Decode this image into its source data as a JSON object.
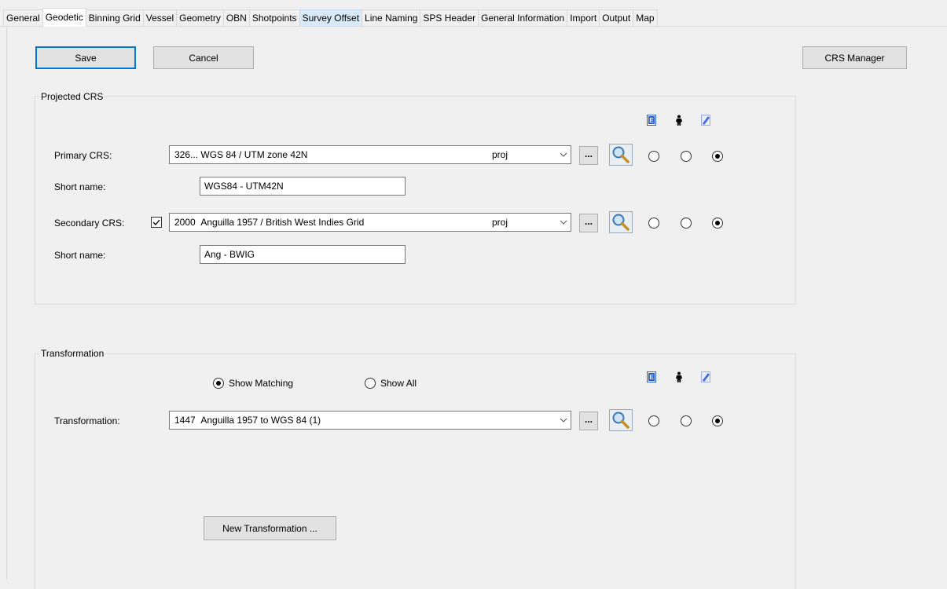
{
  "tabs": [
    {
      "label": "General",
      "state": "normal"
    },
    {
      "label": "Geodetic",
      "state": "active"
    },
    {
      "label": "Binning Grid",
      "state": "normal"
    },
    {
      "label": "Vessel",
      "state": "normal"
    },
    {
      "label": "Geometry",
      "state": "normal"
    },
    {
      "label": "OBN",
      "state": "normal"
    },
    {
      "label": "Shotpoints",
      "state": "normal"
    },
    {
      "label": "Survey Offset",
      "state": "hover"
    },
    {
      "label": "Line Naming",
      "state": "normal"
    },
    {
      "label": "SPS Header",
      "state": "normal"
    },
    {
      "label": "General Information",
      "state": "normal"
    },
    {
      "label": "Import",
      "state": "normal"
    },
    {
      "label": "Output",
      "state": "normal"
    },
    {
      "label": "Map",
      "state": "normal"
    }
  ],
  "toolbar": {
    "save_label": "Save",
    "cancel_label": "Cancel",
    "crs_manager_label": "CRS Manager"
  },
  "projected_crs": {
    "title": "Projected CRS",
    "primary": {
      "label": "Primary CRS:",
      "code": "326...",
      "name": "WGS 84 / UTM zone 42N",
      "type": "proj",
      "short_name_label": "Short name:",
      "short_name": "WGS84 - UTM42N",
      "selected_radio": 3
    },
    "secondary": {
      "label": "Secondary CRS:",
      "enabled": true,
      "code": "2000",
      "name": "Anguilla 1957 / British West Indies Grid",
      "type": "proj",
      "short_name_label": "Short name:",
      "short_name": "Ang - BWIG",
      "selected_radio": 3
    },
    "ellipsis": "..."
  },
  "transformation": {
    "title": "Transformation",
    "show_matching_label": "Show Matching",
    "show_all_label": "Show All",
    "filter": "matching",
    "label": "Transformation:",
    "code": "1447",
    "name": "Anguilla 1957 to WGS 84 (1)",
    "selected_radio": 3,
    "new_transformation_label": "New Transformation ...",
    "ellipsis": "..."
  },
  "icons": {
    "column_1": "epsg-icon",
    "column_2": "person-icon",
    "column_3": "edit-icon"
  },
  "colors": {
    "accent": "#0078d7",
    "tab_hover": "#d8eaf9",
    "icon_blue": "#2a5bd7"
  }
}
